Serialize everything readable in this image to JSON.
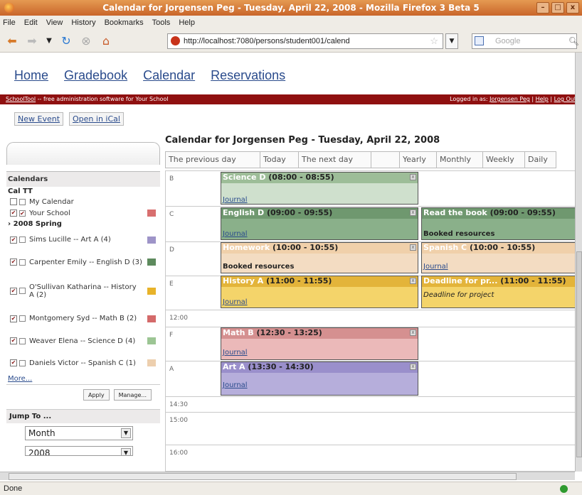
{
  "window": {
    "title": "Calendar for Jorgensen Peg - Tuesday, April 22, 2008 - Mozilla Firefox 3 Beta 5"
  },
  "menu": [
    "File",
    "Edit",
    "View",
    "History",
    "Bookmarks",
    "Tools",
    "Help"
  ],
  "browser": {
    "url": "http://localhost:7080/persons/student001/calend",
    "search_placeholder": "Google",
    "status": "Done"
  },
  "site_nav": [
    "Home",
    "Gradebook",
    "Calendar",
    "Reservations"
  ],
  "header": {
    "brand": "SchoolTool",
    "tagline": " -- free administration software for Your School",
    "logged_prefix": "Logged in as: ",
    "user": "Jorgensen Peg",
    "help": "Help",
    "logout": "Log Out"
  },
  "actions": {
    "new_event": "New Event",
    "open_ical": "Open in iCal"
  },
  "sidebar": {
    "calendars_title": "Calendars",
    "cal_tt": "Cal TT",
    "items": [
      {
        "label": "My Calendar",
        "cb1": "",
        "cb2": "",
        "color": "#c9d8e9"
      },
      {
        "label": "Your School",
        "cb1": "✔",
        "cb2": "✔",
        "color": "#e8a6a6"
      },
      {
        "label": "Sims Lucille -- Art A (4)",
        "cb1": "✔",
        "cb2": "",
        "color": "#b3a8d0"
      },
      {
        "label": "Carpenter Emily -- English D (3)",
        "cb1": "✔",
        "cb2": "",
        "color": "#84a884"
      },
      {
        "label": "O'Sullivan Katharina -- History A (2)",
        "cb1": "✔",
        "cb2": "",
        "color": "#f0c84c"
      },
      {
        "label": "Montgomery Syd -- Math B (2)",
        "cb1": "✔",
        "cb2": "",
        "color": "#e3a3a3"
      },
      {
        "label": "Weaver Elena -- Science D (4)",
        "cb1": "✔",
        "cb2": "",
        "color": "#b9d2b4"
      },
      {
        "label": "Daniels Victor -- Spanish C (1)",
        "cb1": "✔",
        "cb2": "",
        "color": "#f1d9c0"
      }
    ],
    "group_spring": "2008 Spring",
    "more": "More...",
    "apply": "Apply",
    "manage": "Manage...",
    "jump_to": "Jump To ...",
    "jump_month": "Month",
    "jump_year": "2008"
  },
  "calendar": {
    "title": "Calendar for Jorgensen Peg - Tuesday, April 22, 2008",
    "nav": {
      "prev": "The previous day",
      "today": "Today",
      "next": "The next day",
      "yearly": "Yearly",
      "monthly": "Monthly",
      "weekly": "Weekly",
      "daily": "Daily"
    },
    "slots": [
      "B",
      "C",
      "D",
      "E",
      "12:00",
      "F",
      "A",
      "14:30",
      "15:00",
      "16:00"
    ],
    "events": [
      {
        "name": "Science D",
        "time": " (08:00 - 08:55)",
        "body": "Journal",
        "link": true,
        "color": "#cfe0cd",
        "header": "#9dbd98"
      },
      {
        "name": "English D",
        "time": " (09:00 - 09:55)",
        "body": "Journal",
        "link": true,
        "color": "#8ab08a",
        "header": "#6f986f"
      },
      {
        "name": "Read the book",
        "time": " (09:00 - 09:55)",
        "body": "Booked resources",
        "link": false,
        "color": "#8ab08a",
        "header": "#6f986f"
      },
      {
        "name": "Homework",
        "time": " (10:00 - 10:55)",
        "body": "Booked resources",
        "link": false,
        "color": "#f3dcc2",
        "header": "#f0d0aa"
      },
      {
        "name": "Spanish C",
        "time": " (10:00 - 10:55)",
        "body": "Journal",
        "link": true,
        "color": "#f3dcc2",
        "header": "#f0d0aa"
      },
      {
        "name": "History A",
        "time": " (11:00 - 11:55)",
        "body": "Journal",
        "link": true,
        "color": "#f4d46a",
        "header": "#e3b43a"
      },
      {
        "name": "Deadline for pr...",
        "time": " (11:00 - 11:55)",
        "body": "Deadline for project",
        "link": false,
        "color": "#f4d46a",
        "header": "#e3b43a"
      },
      {
        "name": "Math B",
        "time": " (12:30 - 13:25)",
        "body": "Journal",
        "link": true,
        "color": "#ebb9b9",
        "header": "#d59090"
      },
      {
        "name": "Art A",
        "time": " (13:30 - 14:30)",
        "body": "Journal",
        "link": true,
        "color": "#b6aedb",
        "header": "#9a8fcb"
      }
    ]
  }
}
